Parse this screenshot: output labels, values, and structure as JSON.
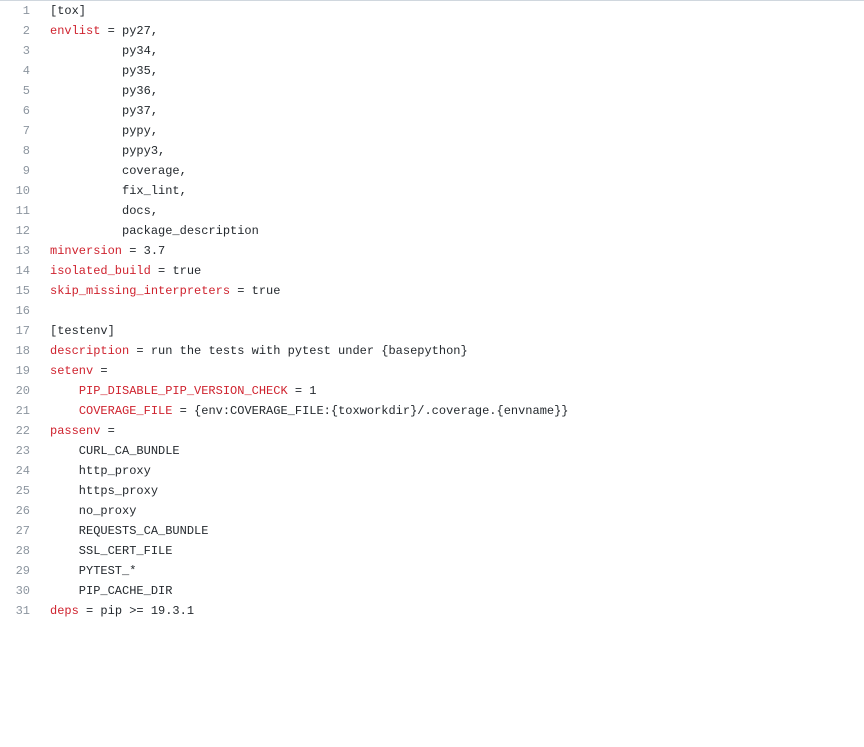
{
  "lines": [
    {
      "n": 1,
      "tokens": [
        {
          "t": "[tox]",
          "c": "tok-section"
        }
      ]
    },
    {
      "n": 2,
      "tokens": [
        {
          "t": "envlist",
          "c": "tok-key"
        },
        {
          "t": " = ",
          "c": "tok-punct"
        },
        {
          "t": "py27,",
          "c": "tok-val"
        }
      ]
    },
    {
      "n": 3,
      "tokens": [
        {
          "t": "          py34,",
          "c": "tok-val"
        }
      ]
    },
    {
      "n": 4,
      "tokens": [
        {
          "t": "          py35,",
          "c": "tok-val"
        }
      ]
    },
    {
      "n": 5,
      "tokens": [
        {
          "t": "          py36,",
          "c": "tok-val"
        }
      ]
    },
    {
      "n": 6,
      "tokens": [
        {
          "t": "          py37,",
          "c": "tok-val"
        }
      ]
    },
    {
      "n": 7,
      "tokens": [
        {
          "t": "          pypy,",
          "c": "tok-val"
        }
      ]
    },
    {
      "n": 8,
      "tokens": [
        {
          "t": "          pypy3,",
          "c": "tok-val"
        }
      ]
    },
    {
      "n": 9,
      "tokens": [
        {
          "t": "          coverage,",
          "c": "tok-val"
        }
      ]
    },
    {
      "n": 10,
      "tokens": [
        {
          "t": "          fix_lint,",
          "c": "tok-val"
        }
      ]
    },
    {
      "n": 11,
      "tokens": [
        {
          "t": "          docs,",
          "c": "tok-val"
        }
      ]
    },
    {
      "n": 12,
      "tokens": [
        {
          "t": "          package_description",
          "c": "tok-val"
        }
      ]
    },
    {
      "n": 13,
      "tokens": [
        {
          "t": "minversion",
          "c": "tok-key"
        },
        {
          "t": " = ",
          "c": "tok-punct"
        },
        {
          "t": "3.7",
          "c": "tok-val"
        }
      ]
    },
    {
      "n": 14,
      "tokens": [
        {
          "t": "isolated_build",
          "c": "tok-key"
        },
        {
          "t": " = ",
          "c": "tok-punct"
        },
        {
          "t": "true",
          "c": "tok-val"
        }
      ]
    },
    {
      "n": 15,
      "tokens": [
        {
          "t": "skip_missing_interpreters",
          "c": "tok-key"
        },
        {
          "t": " = ",
          "c": "tok-punct"
        },
        {
          "t": "true",
          "c": "tok-val"
        }
      ]
    },
    {
      "n": 16,
      "tokens": [
        {
          "t": "",
          "c": "tok-val"
        }
      ]
    },
    {
      "n": 17,
      "tokens": [
        {
          "t": "[testenv]",
          "c": "tok-section"
        }
      ]
    },
    {
      "n": 18,
      "tokens": [
        {
          "t": "description",
          "c": "tok-key"
        },
        {
          "t": " = ",
          "c": "tok-punct"
        },
        {
          "t": "run the tests with pytest under {basepython}",
          "c": "tok-val"
        }
      ]
    },
    {
      "n": 19,
      "tokens": [
        {
          "t": "setenv",
          "c": "tok-key"
        },
        {
          "t": " =",
          "c": "tok-punct"
        }
      ]
    },
    {
      "n": 20,
      "tokens": [
        {
          "t": "    ",
          "c": "tok-val"
        },
        {
          "t": "PIP_DISABLE_PIP_VERSION_CHECK",
          "c": "tok-key"
        },
        {
          "t": " = ",
          "c": "tok-punct"
        },
        {
          "t": "1",
          "c": "tok-val"
        }
      ]
    },
    {
      "n": 21,
      "tokens": [
        {
          "t": "    ",
          "c": "tok-val"
        },
        {
          "t": "COVERAGE_FILE",
          "c": "tok-key"
        },
        {
          "t": " = ",
          "c": "tok-punct"
        },
        {
          "t": "{env:COVERAGE_FILE:{toxworkdir}/.coverage.{envname}}",
          "c": "tok-val"
        }
      ]
    },
    {
      "n": 22,
      "tokens": [
        {
          "t": "passenv",
          "c": "tok-key"
        },
        {
          "t": " =",
          "c": "tok-punct"
        }
      ]
    },
    {
      "n": 23,
      "tokens": [
        {
          "t": "    CURL_CA_BUNDLE",
          "c": "tok-val"
        }
      ]
    },
    {
      "n": 24,
      "tokens": [
        {
          "t": "    http_proxy",
          "c": "tok-val"
        }
      ]
    },
    {
      "n": 25,
      "tokens": [
        {
          "t": "    https_proxy",
          "c": "tok-val"
        }
      ]
    },
    {
      "n": 26,
      "tokens": [
        {
          "t": "    no_proxy",
          "c": "tok-val"
        }
      ]
    },
    {
      "n": 27,
      "tokens": [
        {
          "t": "    REQUESTS_CA_BUNDLE",
          "c": "tok-val"
        }
      ]
    },
    {
      "n": 28,
      "tokens": [
        {
          "t": "    SSL_CERT_FILE",
          "c": "tok-val"
        }
      ]
    },
    {
      "n": 29,
      "tokens": [
        {
          "t": "    PYTEST_*",
          "c": "tok-val"
        }
      ]
    },
    {
      "n": 30,
      "tokens": [
        {
          "t": "    PIP_CACHE_DIR",
          "c": "tok-val"
        }
      ]
    },
    {
      "n": 31,
      "tokens": [
        {
          "t": "deps",
          "c": "tok-key"
        },
        {
          "t": " = ",
          "c": "tok-punct"
        },
        {
          "t": "pip >= 19.3.1",
          "c": "tok-val"
        }
      ]
    }
  ]
}
